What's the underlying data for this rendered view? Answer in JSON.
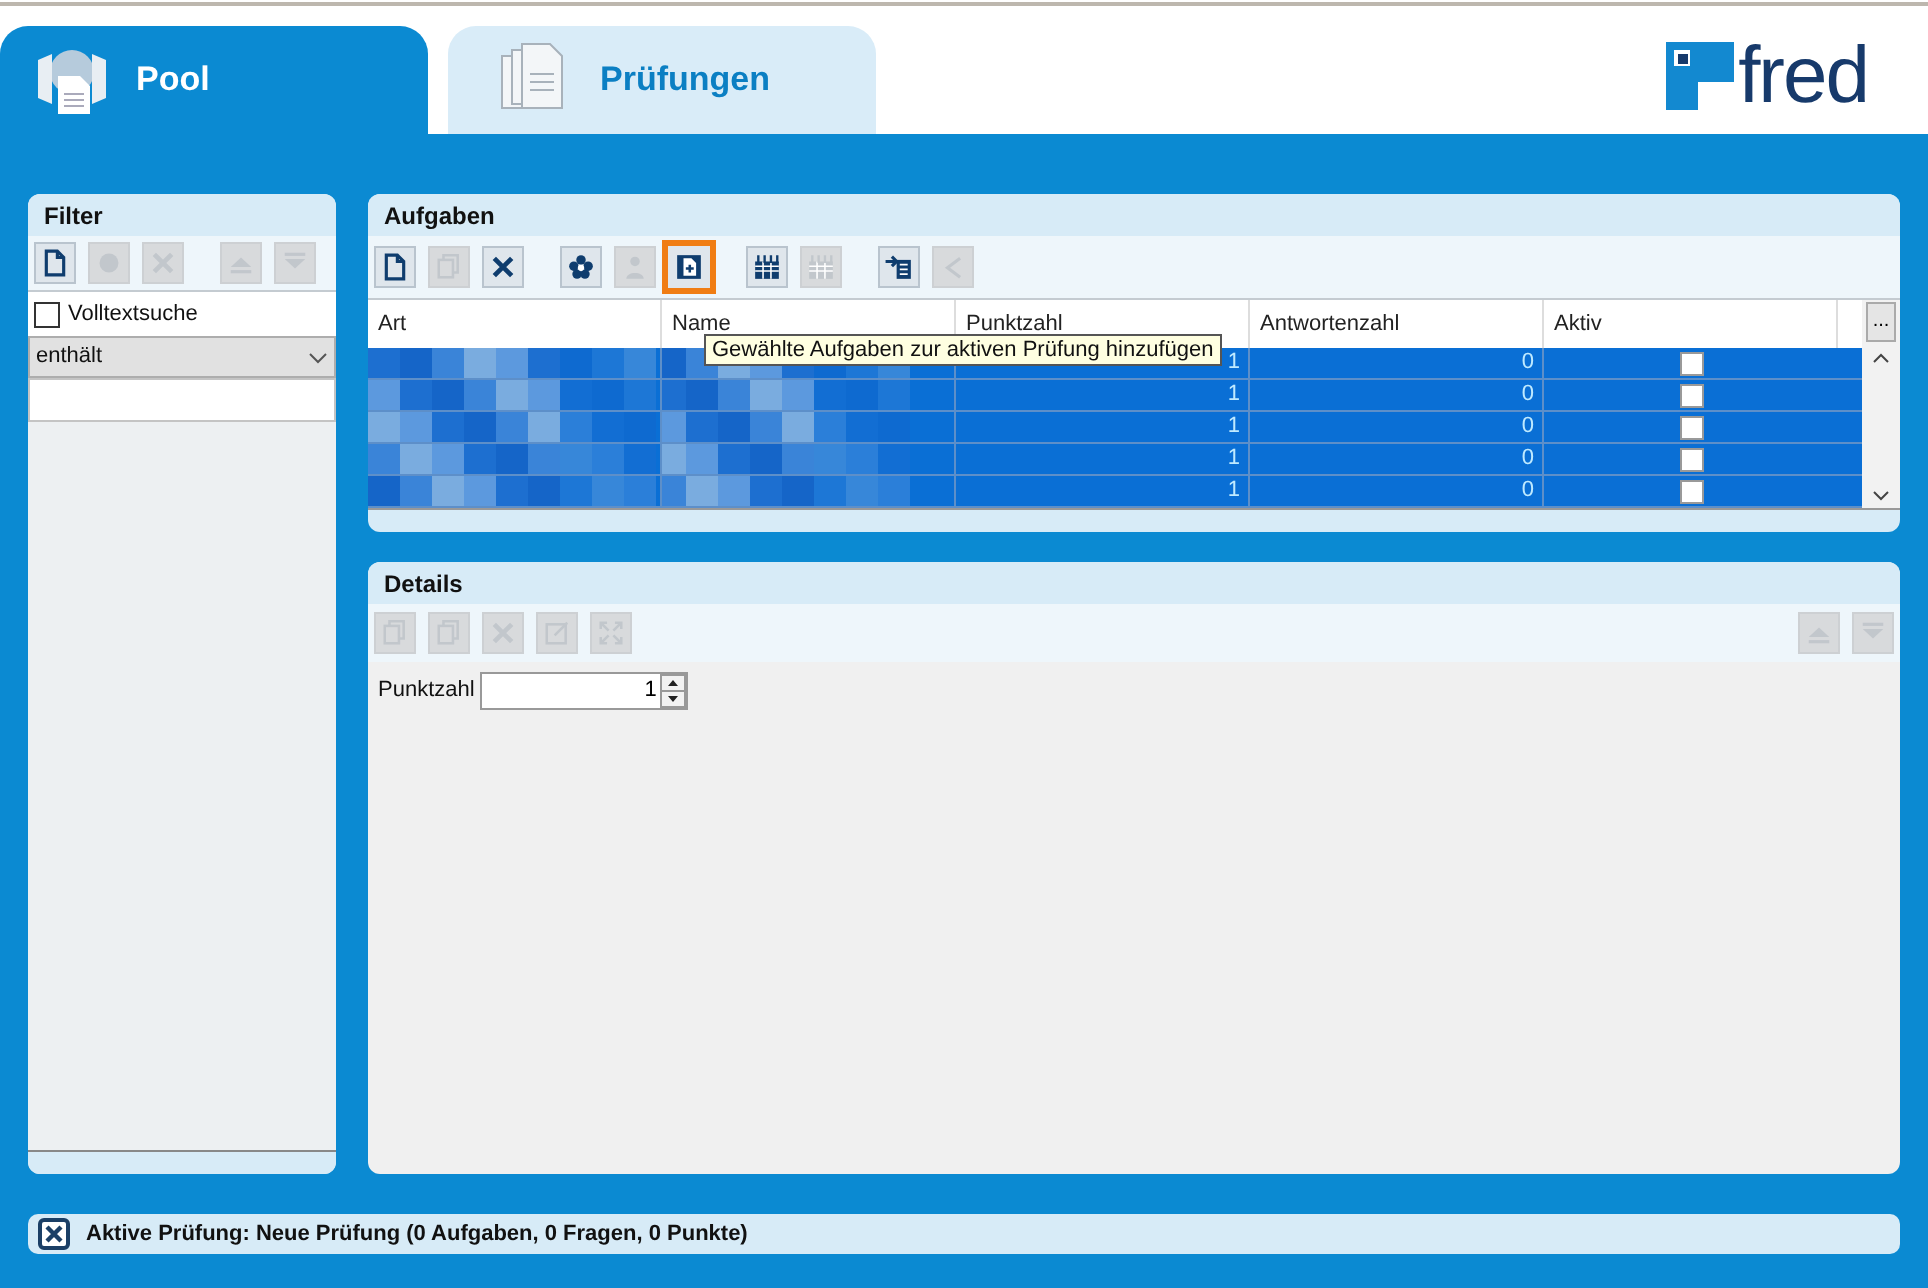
{
  "tabs": [
    {
      "label": "Pool",
      "kind": "pool",
      "selected": true
    },
    {
      "label": "Prüfungen",
      "kind": "documents",
      "selected": false
    }
  ],
  "logo": {
    "text": "fred"
  },
  "filter": {
    "title": "Filter",
    "toolbar": [
      {
        "kind": "new",
        "enabled": true
      },
      {
        "kind": "gear",
        "enabled": false
      },
      {
        "kind": "delete",
        "enabled": false
      },
      {
        "kind": "gap"
      },
      {
        "kind": "up",
        "enabled": false
      },
      {
        "kind": "down",
        "enabled": false
      }
    ],
    "fulltext": {
      "label": "Volltextsuche",
      "checked": false
    },
    "mode": {
      "value": "enthält"
    }
  },
  "tasks": {
    "title": "Aufgaben",
    "toolbar": [
      {
        "kind": "new",
        "enabled": true,
        "highlighted": false
      },
      {
        "kind": "copy",
        "enabled": false,
        "highlighted": false
      },
      {
        "kind": "delete",
        "enabled": true,
        "highlighted": false
      },
      {
        "kind": "gap"
      },
      {
        "kind": "flower",
        "enabled": true,
        "highlighted": false
      },
      {
        "kind": "person",
        "enabled": false,
        "highlighted": false
      },
      {
        "kind": "add",
        "enabled": true,
        "highlighted": true
      },
      {
        "kind": "gap"
      },
      {
        "kind": "grid",
        "enabled": true,
        "highlighted": false
      },
      {
        "kind": "grid",
        "enabled": false,
        "highlighted": false
      },
      {
        "kind": "gap"
      },
      {
        "kind": "import",
        "enabled": true,
        "highlighted": false
      },
      {
        "kind": "back",
        "enabled": false,
        "highlighted": false
      }
    ],
    "tooltip": "Gewählte Aufgaben zur aktiven Prüfung hinzufügen",
    "columns": [
      "Art",
      "Name",
      "Punktzahl",
      "Antwortenzahl",
      "Aktiv"
    ],
    "more_button": "...",
    "rows": [
      {
        "punktzahl": "1",
        "antwortenzahl": "0",
        "aktiv": false,
        "selected": true
      },
      {
        "punktzahl": "1",
        "antwortenzahl": "0",
        "aktiv": false,
        "selected": true
      },
      {
        "punktzahl": "1",
        "antwortenzahl": "0",
        "aktiv": false,
        "selected": true
      },
      {
        "punktzahl": "1",
        "antwortenzahl": "0",
        "aktiv": false,
        "selected": true
      },
      {
        "punktzahl": "1",
        "antwortenzahl": "0",
        "aktiv": false,
        "selected": true
      }
    ]
  },
  "details": {
    "title": "Details",
    "toolbar_left": [
      {
        "kind": "copy",
        "enabled": false
      },
      {
        "kind": "copy",
        "enabled": false
      },
      {
        "kind": "delete",
        "enabled": false
      },
      {
        "kind": "edit",
        "enabled": false
      },
      {
        "kind": "expand",
        "enabled": false
      }
    ],
    "toolbar_right": [
      {
        "kind": "up",
        "enabled": false
      },
      {
        "kind": "down",
        "enabled": false
      }
    ],
    "field": {
      "label": "Punktzahl",
      "value": "1"
    }
  },
  "status": {
    "text": "Aktive Prüfung: Neue Prüfung (0 Aufgaben, 0 Fragen, 0 Punkte)"
  }
}
